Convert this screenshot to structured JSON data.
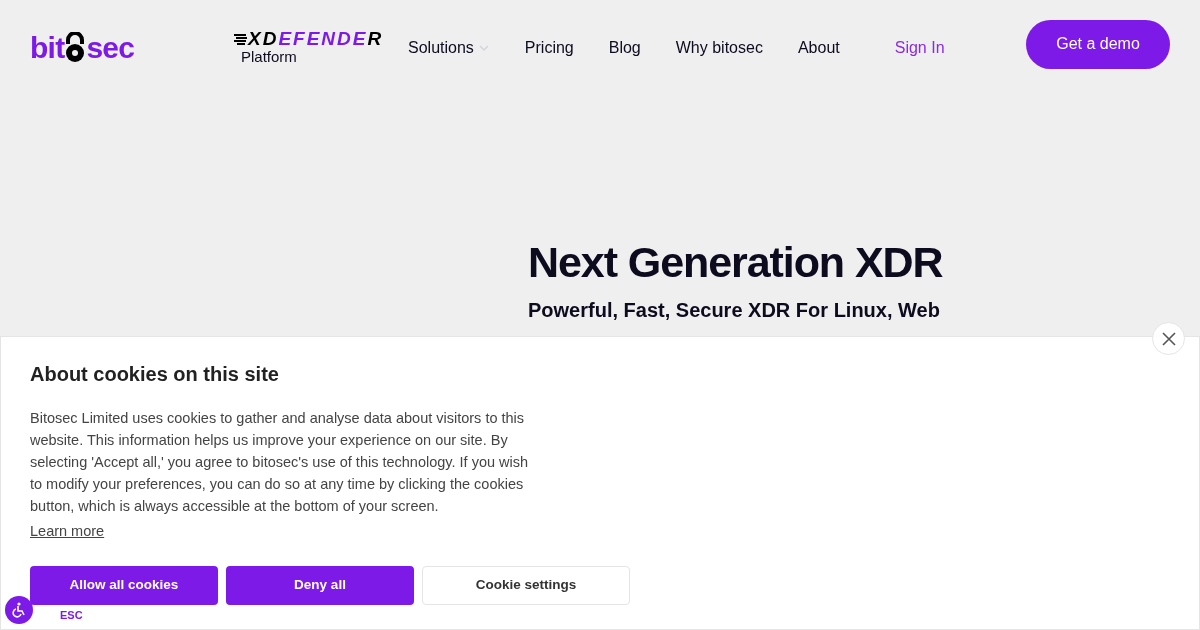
{
  "header": {
    "logo": {
      "before": "bit",
      "after": "sec"
    },
    "product": {
      "parts": [
        {
          "text": "XD",
          "accent": false
        },
        {
          "text": "EFENDE",
          "accent": true
        },
        {
          "text": "R",
          "accent": false
        }
      ],
      "caption": "Platform"
    },
    "nav": [
      {
        "label": "Solutions",
        "dropdown": true
      },
      {
        "label": "Pricing",
        "dropdown": false
      },
      {
        "label": "Blog",
        "dropdown": false
      },
      {
        "label": "Why bitosec",
        "dropdown": false
      },
      {
        "label": "About",
        "dropdown": false
      }
    ],
    "sign_in": "Sign In",
    "cta": "Get a demo"
  },
  "hero": {
    "title": "Next Generation XDR",
    "subtitle": "Powerful, Fast, Secure XDR For Linux, Web"
  },
  "cookie_banner": {
    "title": "About cookies on this site",
    "body": "Bitosec Limited uses cookies to gather and analyse data about visitors to this website. This information helps us improve your experience on our site. By selecting 'Accept all,' you agree to bitosec's use of this technology. If you wish to modify your preferences, you can do so at any time by clicking the cookies button, which is always accessible at the bottom of your screen.",
    "link": "Learn more",
    "buttons": [
      {
        "label": "Allow all cookies",
        "kind": "primary"
      },
      {
        "label": "Deny all",
        "kind": "primary"
      },
      {
        "label": "Cookie settings",
        "kind": "secondary"
      }
    ],
    "esc": "ESC"
  }
}
